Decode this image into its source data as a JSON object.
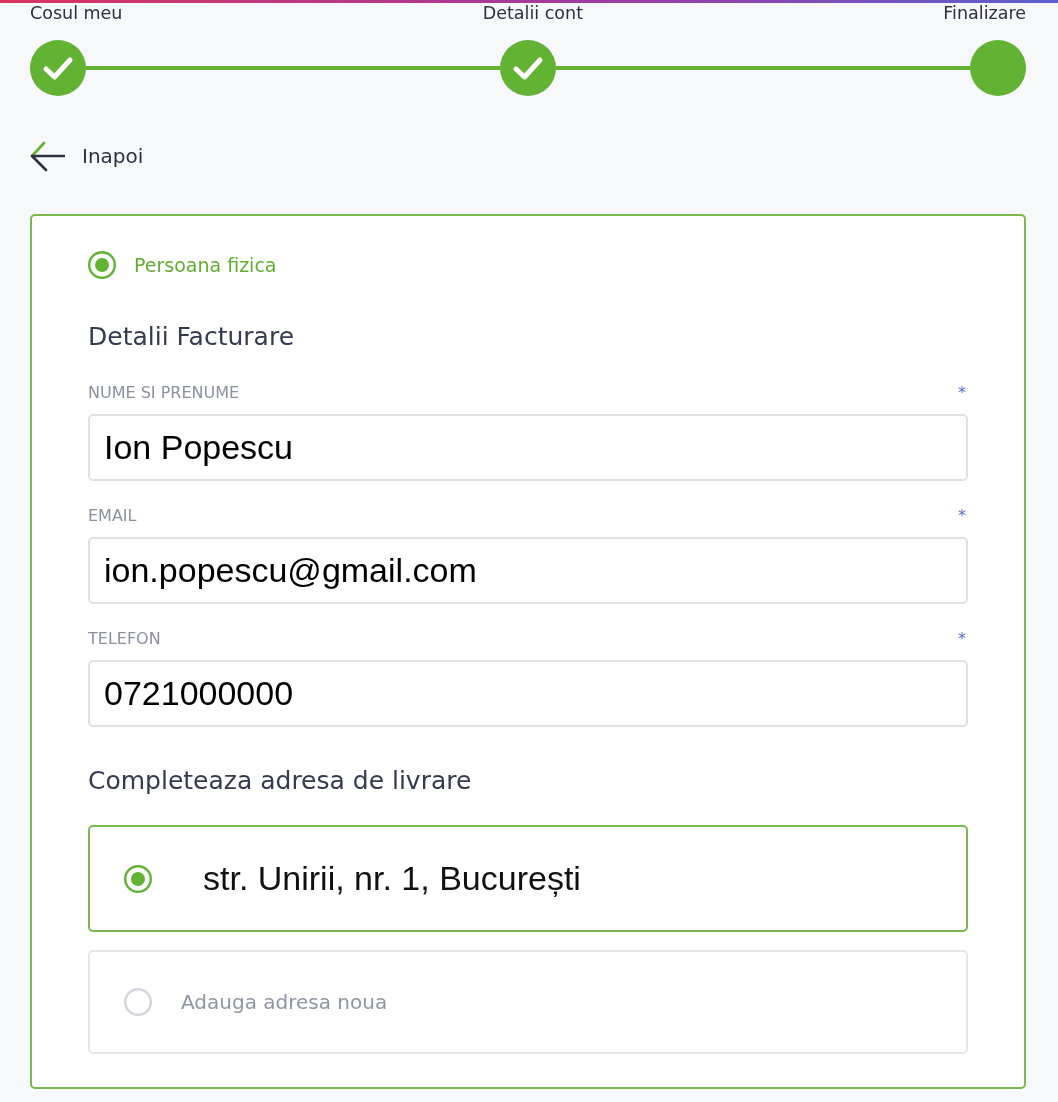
{
  "stepper": {
    "steps": [
      {
        "label": "Cosul meu",
        "completed": true
      },
      {
        "label": "Detalii cont",
        "completed": true
      },
      {
        "label": "Finalizare",
        "completed": false
      }
    ]
  },
  "back_link": {
    "label": "Inapoi"
  },
  "customer_type": {
    "label": "Persoana fizica",
    "selected": true
  },
  "billing": {
    "title": "Detalii Facturare",
    "fields": [
      {
        "label": "NUME SI PRENUME",
        "required_mark": "*",
        "value": "Ion Popescu"
      },
      {
        "label": "EMAIL",
        "required_mark": "*",
        "value": "ion.popescu@gmail.com"
      },
      {
        "label": "TELEFON",
        "required_mark": "*",
        "value": "0721000000"
      }
    ]
  },
  "delivery": {
    "title": "Completeaza adresa de livrare",
    "options": [
      {
        "kind": "saved",
        "label": "str. Unirii, nr. 1, București",
        "selected": true
      },
      {
        "kind": "new",
        "label": "Adauga adresa noua",
        "selected": false
      }
    ]
  }
}
